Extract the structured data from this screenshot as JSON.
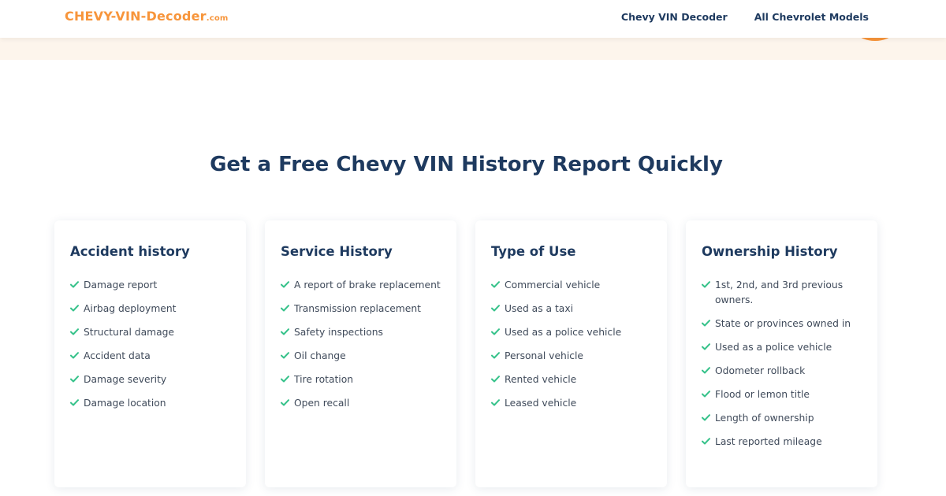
{
  "header": {
    "logo_main": "CHEVY-VIN-Decoder",
    "logo_tld": ".com",
    "nav": [
      {
        "label": "Chevy VIN Decoder"
      },
      {
        "label": "All Chevrolet Models"
      }
    ]
  },
  "section": {
    "title": "Get a Free Chevy VIN History Report Quickly"
  },
  "colors": {
    "brand_orange": "#f7953b",
    "navy": "#1e3a5f",
    "check_green": "#36c28a",
    "hero_bg": "#fdf5ec"
  },
  "cards": [
    {
      "title": "Accident history",
      "items": [
        "Damage report",
        "Airbag deployment",
        "Structural damage",
        "Accident data",
        "Damage severity",
        "Damage location"
      ]
    },
    {
      "title": "Service History",
      "items": [
        "A report of brake replacement",
        "Transmission replacement",
        "Safety inspections",
        "Oil change",
        "Tire rotation",
        "Open recall"
      ]
    },
    {
      "title": "Type of Use",
      "items": [
        "Commercial vehicle",
        "Used as a taxi",
        "Used as a police vehicle",
        "Personal vehicle",
        "Rented vehicle",
        "Leased vehicle"
      ]
    },
    {
      "title": "Ownership History",
      "items": [
        "1st, 2nd, and 3rd previous owners.",
        "State or provinces owned in",
        "Used as a police vehicle",
        "Odometer rollback",
        "Flood or lemon title",
        "Length of ownership",
        "Last reported mileage"
      ]
    }
  ]
}
